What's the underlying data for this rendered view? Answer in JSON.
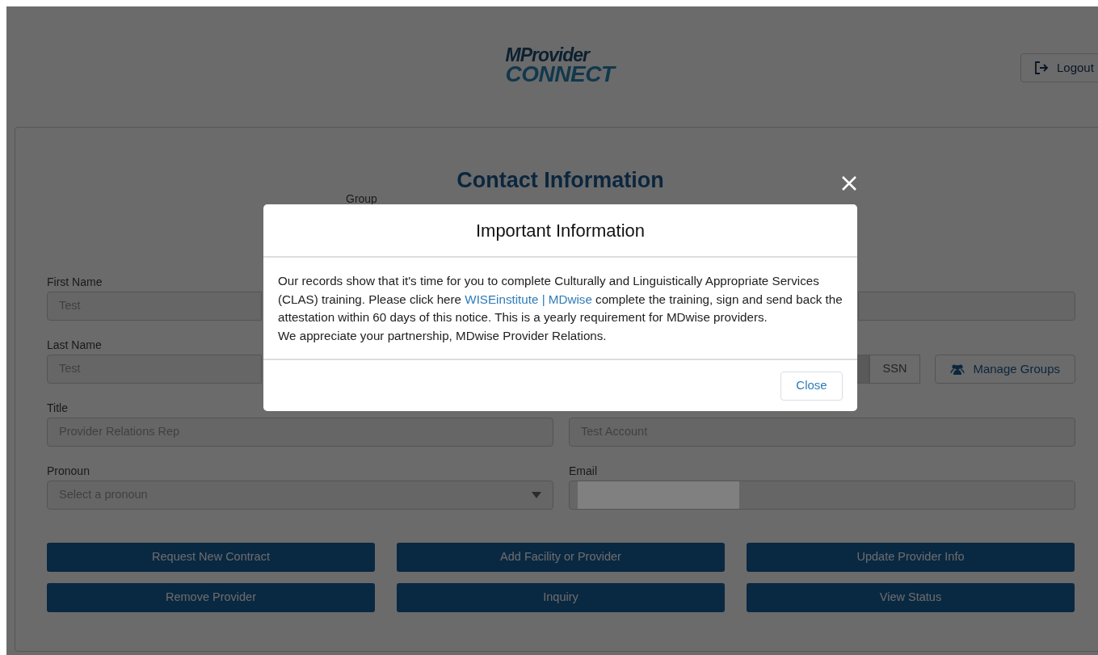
{
  "header": {
    "logo": [
      "MProvider",
      "CONNECT"
    ],
    "logout_button": "Logout"
  },
  "page_title": "Contact Information",
  "group_label": "Group",
  "left_fields": [
    {
      "label": "First Name",
      "value": "Test",
      "kind": "text"
    },
    {
      "label": "Last Name",
      "value": "Test",
      "kind": "text"
    },
    {
      "label": "Title",
      "value": "Provider Relations Rep",
      "kind": "text"
    },
    {
      "label": "Pronoun",
      "value": "Select a pronoun",
      "kind": "select"
    }
  ],
  "right_fields": [
    {
      "kind": "text"
    },
    {
      "kind": "toggle",
      "options": [
        {
          "selected": true
        },
        {
          "label": "SSN",
          "selected": false
        }
      ],
      "manage_button": "Manage Groups"
    },
    {
      "kind": "text",
      "value": "Test Account"
    },
    {
      "kind": "text",
      "label": "Email",
      "redacted": true
    }
  ],
  "action_buttons": [
    "Request New Contract",
    "Add Facility or Provider",
    "Update Provider Info",
    "Remove Provider",
    "Inquiry",
    "View Status"
  ],
  "modal": {
    "title": "Important Information",
    "paragraphs": [
      {
        "before": "Our records show that it's time for you to complete Culturally and Linguistically Appropriate Services (CLAS) training. Please click here ",
        "link": "WISEinstitute | MDwise",
        "after": " complete the training, sign and send back the attestation within 60 days of this notice. This is a yearly requirement for MDwise providers."
      },
      {
        "before": "We appreciate your partnership, MDwise Provider Relations."
      }
    ],
    "close_button": "Close"
  }
}
